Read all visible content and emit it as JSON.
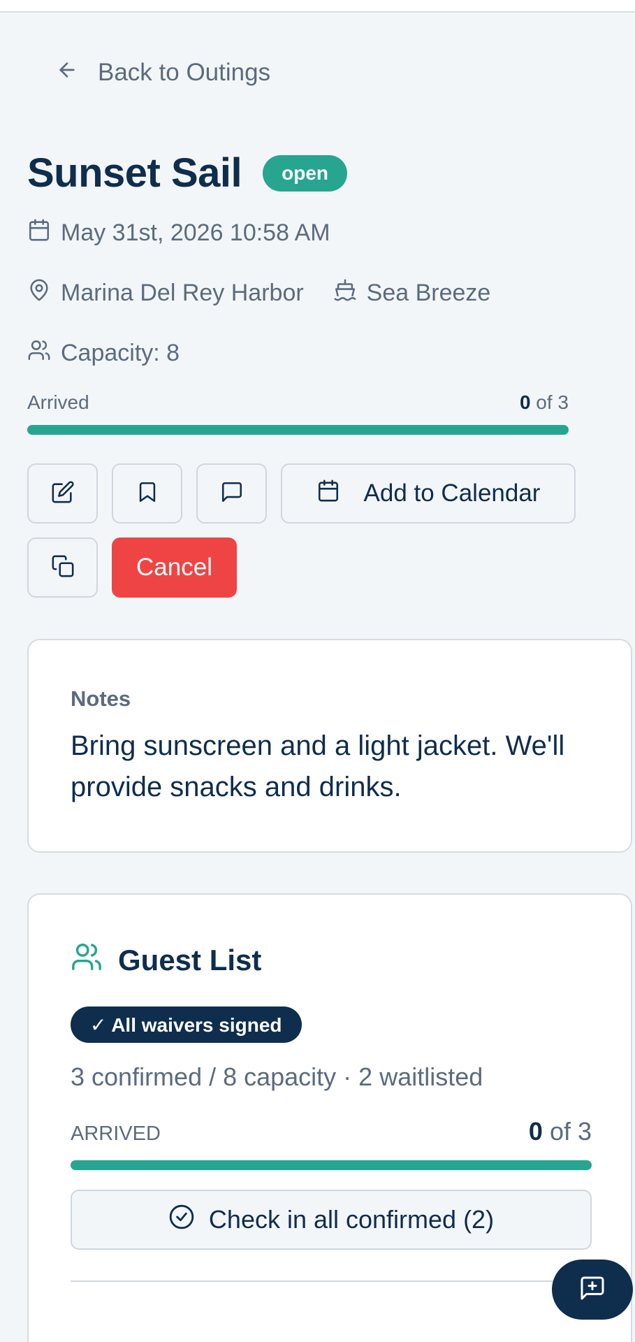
{
  "nav": {
    "back_label": "Back to Outings"
  },
  "outing": {
    "title": "Sunset Sail",
    "status": "open",
    "datetime": "May 31st, 2026 10:58 AM",
    "location": "Marina Del Rey Harbor",
    "boat": "Sea Breeze",
    "capacity_text": "Capacity: 8",
    "arrived_label": "Arrived",
    "arrived_count": "0",
    "arrived_total": "of 3",
    "arrived_progress": 1
  },
  "actions": {
    "add_to_calendar": "Add to Calendar",
    "cancel": "Cancel"
  },
  "notes": {
    "label": "Notes",
    "text": "Bring sunscreen and a light jacket. We'll provide snacks and drinks."
  },
  "guest_list": {
    "title": "Guest List",
    "waiver_badge": "✓ All waivers signed",
    "stats": "3 confirmed / 8 capacity · 2 waitlisted",
    "arrived_label": "ARRIVED",
    "arrived_count": "0",
    "arrived_total": "of 3",
    "arrived_progress": 1,
    "checkin_label": "Check in all confirmed (2)"
  },
  "icons": {
    "back": "arrow-left-icon",
    "calendar": "calendar-icon",
    "location": "map-pin-icon",
    "boat": "ship-icon",
    "capacity": "users-icon",
    "edit": "edit-icon",
    "bookmark": "bookmark-icon",
    "comment": "message-square-icon",
    "duplicate": "copy-icon",
    "check": "check-circle-icon",
    "feedback": "message-plus-icon"
  },
  "colors": {
    "accent": "#27a590",
    "primary": "#0f2d4d",
    "danger": "#ef4444",
    "muted": "#5b6b7d"
  }
}
